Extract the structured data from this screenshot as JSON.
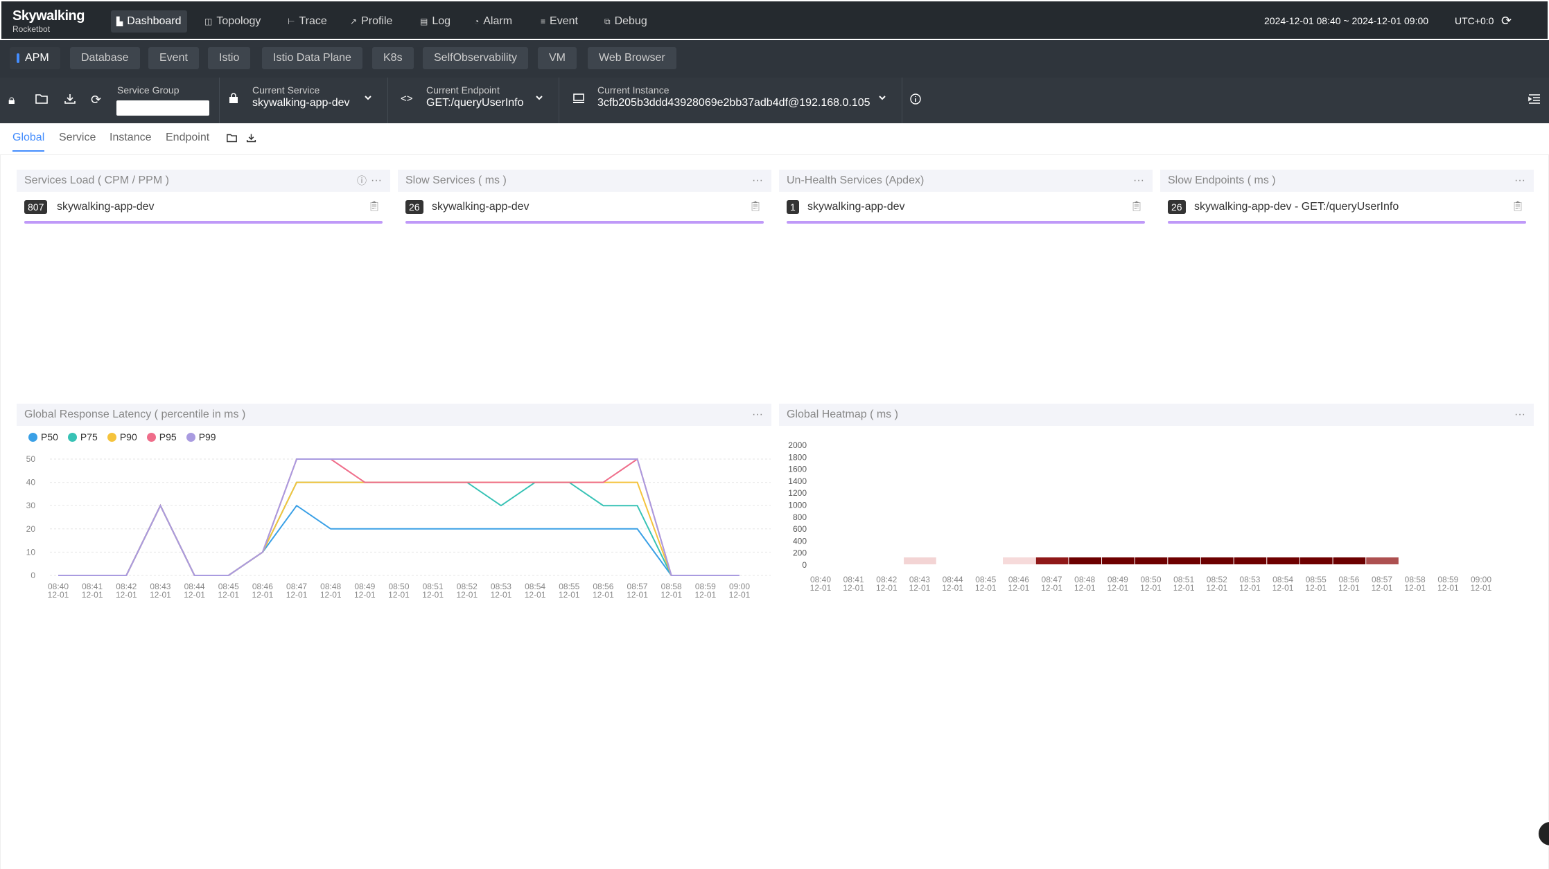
{
  "header": {
    "logo_title": "Skywalking",
    "logo_subtitle": "Rocketbot",
    "nav": [
      {
        "label": "Dashboard",
        "icon": "▙"
      },
      {
        "label": "Topology",
        "icon": "◫"
      },
      {
        "label": "Trace",
        "icon": "⊢"
      },
      {
        "label": "Profile",
        "icon": "↗"
      },
      {
        "label": "Log",
        "icon": "▤"
      },
      {
        "label": "Alarm",
        "icon": "◔"
      },
      {
        "label": "Event",
        "icon": "≡"
      },
      {
        "label": "Debug",
        "icon": "⧉"
      }
    ],
    "time_range": "2024-12-01 08:40 ~ 2024-12-01 09:00",
    "timezone": "UTC+0:0",
    "refresh_icon": "⟳"
  },
  "layers": [
    "APM",
    "Database",
    "Event",
    "Istio",
    "Istio Data Plane",
    "K8s",
    "SelfObservability",
    "VM",
    "Web Browser"
  ],
  "selectors": {
    "service_group_label": "Service Group",
    "current_service_label": "Current Service",
    "current_service": "skywalking-app-dev",
    "current_endpoint_label": "Current Endpoint",
    "current_endpoint": "GET:/queryUserInfo",
    "current_instance_label": "Current Instance",
    "current_instance": "3cfb205b3ddd43928069e2bb37adb4df@192.168.0.105"
  },
  "tabs": [
    "Global",
    "Service",
    "Instance",
    "Endpoint"
  ],
  "widgets": {
    "services_load": {
      "title": "Services Load ( CPM / PPM )",
      "badge": "807",
      "name": "skywalking-app-dev"
    },
    "slow_services": {
      "title": "Slow Services ( ms )",
      "badge": "26",
      "name": "skywalking-app-dev"
    },
    "unhealth_services": {
      "title": "Un-Health Services (Apdex)",
      "badge": "1",
      "name": "skywalking-app-dev"
    },
    "slow_endpoints": {
      "title": "Slow Endpoints ( ms )",
      "badge": "26",
      "name": "skywalking-app-dev - GET:/queryUserInfo"
    },
    "latency": {
      "title": "Global Response Latency ( percentile in ms )"
    },
    "heatmap": {
      "title": "Global Heatmap ( ms )"
    }
  },
  "more_icon": "···",
  "chart_data": [
    {
      "type": "line",
      "title": "Global Response Latency ( percentile in ms )",
      "x": [
        "08:40",
        "08:41",
        "08:42",
        "08:43",
        "08:44",
        "08:45",
        "08:46",
        "08:47",
        "08:48",
        "08:49",
        "08:50",
        "08:51",
        "08:52",
        "08:53",
        "08:54",
        "08:55",
        "08:56",
        "08:57",
        "08:58",
        "08:59",
        "09:00"
      ],
      "x_sub": "12-01",
      "ylim": [
        0,
        50
      ],
      "yticks": [
        0,
        10,
        20,
        30,
        40,
        50
      ],
      "series": [
        {
          "name": "P50",
          "color": "#3aa0e6",
          "values": [
            0,
            0,
            0,
            30,
            0,
            0,
            10,
            30,
            20,
            20,
            20,
            20,
            20,
            20,
            20,
            20,
            20,
            20,
            0,
            0,
            0
          ]
        },
        {
          "name": "P75",
          "color": "#37c2b5",
          "values": [
            0,
            0,
            0,
            30,
            0,
            0,
            10,
            40,
            40,
            40,
            40,
            40,
            40,
            30,
            40,
            40,
            30,
            30,
            0,
            0,
            0
          ]
        },
        {
          "name": "P90",
          "color": "#f5c33c",
          "values": [
            0,
            0,
            0,
            30,
            0,
            0,
            10,
            40,
            40,
            40,
            40,
            40,
            40,
            40,
            40,
            40,
            40,
            40,
            0,
            0,
            0
          ]
        },
        {
          "name": "P95",
          "color": "#ef6d8a",
          "values": [
            0,
            0,
            0,
            30,
            0,
            0,
            10,
            50,
            50,
            40,
            40,
            40,
            40,
            40,
            40,
            40,
            40,
            50,
            0,
            0,
            0
          ]
        },
        {
          "name": "P99",
          "color": "#a99be0",
          "values": [
            0,
            0,
            0,
            30,
            0,
            0,
            10,
            50,
            50,
            50,
            50,
            50,
            50,
            50,
            50,
            50,
            50,
            50,
            0,
            0,
            0
          ]
        }
      ],
      "grid": true,
      "legend": "top-left"
    },
    {
      "type": "heatmap",
      "title": "Global Heatmap ( ms )",
      "x": [
        "08:40",
        "08:41",
        "08:42",
        "08:43",
        "08:44",
        "08:45",
        "08:46",
        "08:47",
        "08:48",
        "08:49",
        "08:50",
        "08:51",
        "08:52",
        "08:53",
        "08:54",
        "08:55",
        "08:56",
        "08:57",
        "08:58",
        "08:59",
        "09:00"
      ],
      "x_sub": "12-01",
      "yticks": [
        0,
        200,
        400,
        600,
        800,
        1000,
        1200,
        1400,
        1600,
        1800,
        2000
      ],
      "ylim": [
        0,
        2000
      ],
      "row0_intensity": [
        0,
        0,
        0,
        0.08,
        0,
        0,
        0.06,
        0.75,
        0.98,
        0.97,
        0.97,
        0.97,
        0.98,
        0.97,
        0.97,
        0.97,
        0.98,
        0.55,
        0,
        0,
        0
      ]
    }
  ]
}
